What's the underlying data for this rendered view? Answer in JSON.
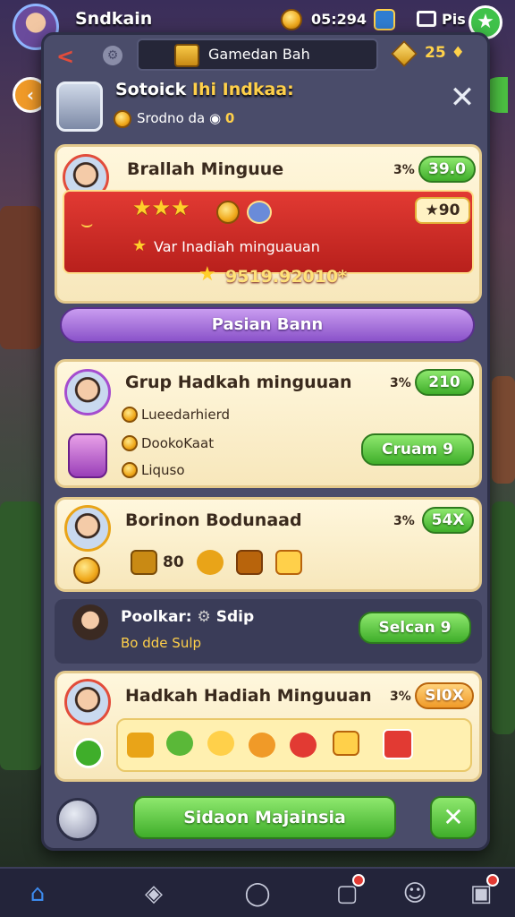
{
  "top_bar": {
    "player_name": "Sndkain",
    "time": "05:294",
    "pis_label": "Pis"
  },
  "modal": {
    "title": "Gamedan Bah",
    "gem_value": "25",
    "header_title_a": "Sotoick",
    "header_title_b": "Ihi Indkaa:",
    "header_sub_a": "Srodno da",
    "header_sub_b": "0"
  },
  "cards": [
    {
      "title": "Brallah Minguue",
      "pct": "3%",
      "badge": "39.0",
      "bonus": "90",
      "line1": "Var Inadiah minguauan",
      "line2": "9519.92010*"
    },
    {
      "title": "Grup Hadkah minguuan",
      "pct": "3%",
      "badge": "210",
      "items": [
        "Lueedarhierd",
        "DookoKaat",
        "Liquso"
      ],
      "button": "Cruam 9"
    },
    {
      "title": "Borinon Bodunaad",
      "pct": "3%",
      "badge": "54X",
      "item_count": "80"
    },
    {
      "title": "Hadkah Hadiah Minguuan",
      "pct": "3%",
      "badge": "SI0X"
    }
  ],
  "purple_button": "Pasian Bann",
  "dark_row": {
    "name": "Poolkar:",
    "s1": "Sdip",
    "sub": "Bo dde",
    "s2": "Sulp",
    "button": "Selcan 9"
  },
  "main_button": "Sidaon Majainsia",
  "colors": {
    "accent_green": "#3fae2a",
    "accent_red": "#e23a33",
    "accent_purple": "#8a52c9",
    "gold": "#f0a91b"
  }
}
